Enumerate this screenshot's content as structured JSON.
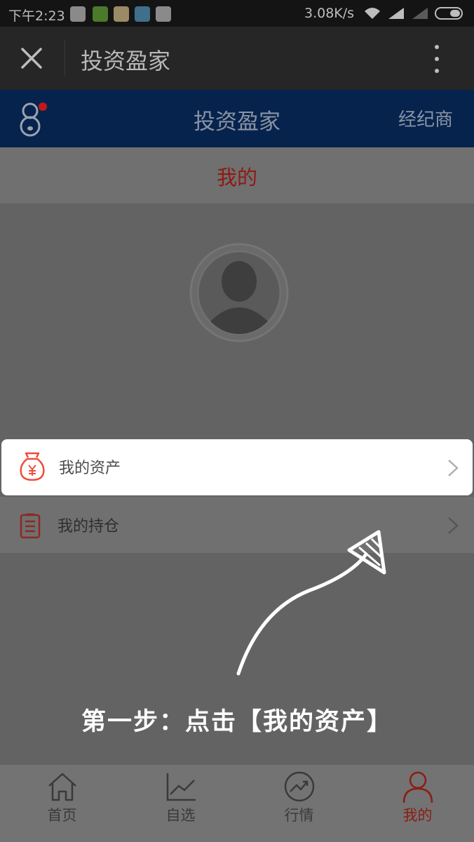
{
  "status_bar": {
    "time": "下午2:23",
    "net_speed": "3.08K/s"
  },
  "title_bar": {
    "close_icon": "close-icon",
    "title": "投资盈家",
    "more_icon": "more-vertical-icon"
  },
  "app_header": {
    "logo_icon": "logo-icon",
    "title": "投资盈家",
    "broker_label": "经纪商"
  },
  "page": {
    "section_title": "我的",
    "menu": [
      {
        "label": "我的资产",
        "icon": "money-bag-icon"
      },
      {
        "label": "我的持仓",
        "icon": "clipboard-icon"
      }
    ]
  },
  "guide": {
    "text": "第一步：点击【我的资产】"
  },
  "bottom_nav": [
    {
      "label": "首页",
      "icon": "home-icon"
    },
    {
      "label": "自选",
      "icon": "line-chart-icon"
    },
    {
      "label": "行情",
      "icon": "trend-icon"
    },
    {
      "label": "我的",
      "icon": "person-icon",
      "active": true
    }
  ],
  "colors": {
    "active_red": "#8b1d14",
    "header_blue": "#06234e",
    "bag_red": "#f04b3c"
  }
}
